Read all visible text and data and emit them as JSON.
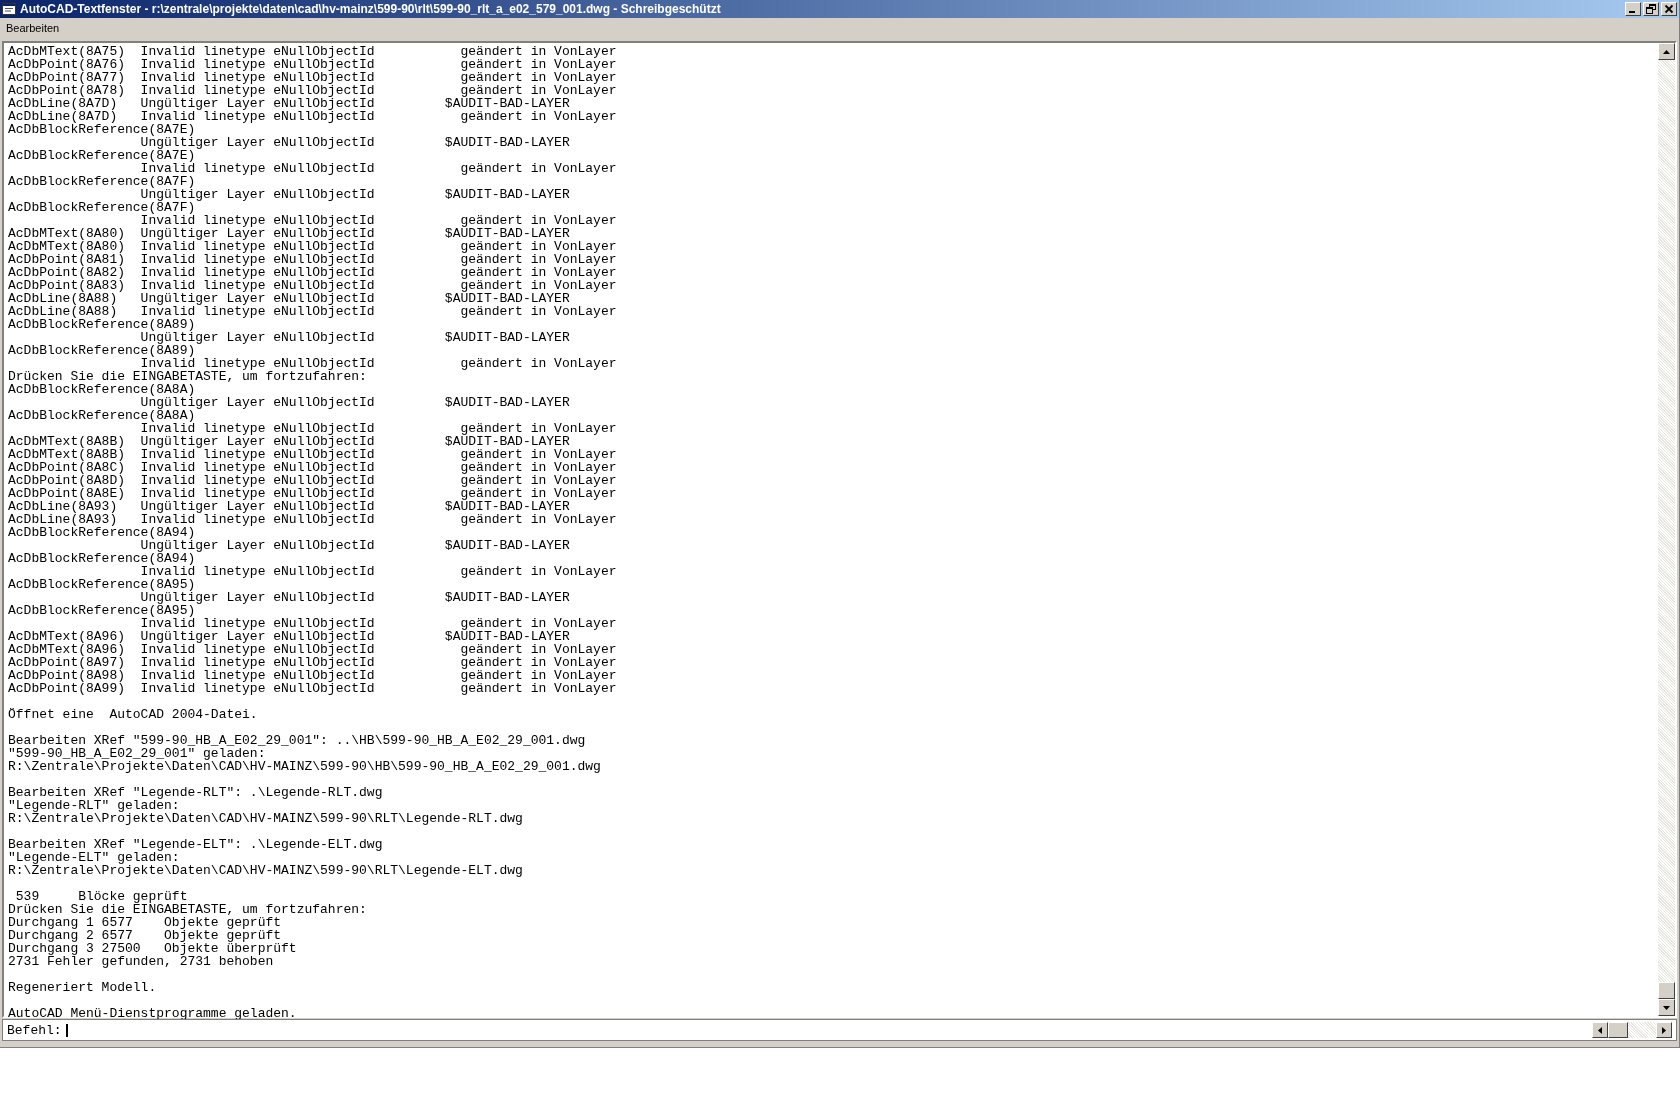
{
  "window": {
    "title": "AutoCAD-Textfenster - r:\\zentrale\\projekte\\daten\\cad\\hv-mainz\\599-90\\rlt\\599-90_rlt_a_e02_579_001.dwg - Schreibgeschützt"
  },
  "menu": [
    "Bearbeiten"
  ],
  "output_blocks": [
    [
      "AcDbMText(8A75)  Invalid linetype eNullObjectId           geändert in VonLayer",
      "AcDbPoint(8A76)  Invalid linetype eNullObjectId           geändert in VonLayer",
      "AcDbPoint(8A77)  Invalid linetype eNullObjectId           geändert in VonLayer",
      "AcDbPoint(8A78)  Invalid linetype eNullObjectId           geändert in VonLayer",
      "AcDbLine(8A7D)   Ungültiger Layer eNullObjectId         $AUDIT-BAD-LAYER",
      "AcDbLine(8A7D)   Invalid linetype eNullObjectId           geändert in VonLayer",
      "AcDbBlockReference(8A7E)",
      "                 Ungültiger Layer eNullObjectId         $AUDIT-BAD-LAYER",
      "AcDbBlockReference(8A7E)",
      "                 Invalid linetype eNullObjectId           geändert in VonLayer",
      "AcDbBlockReference(8A7F)",
      "                 Ungültiger Layer eNullObjectId         $AUDIT-BAD-LAYER",
      "AcDbBlockReference(8A7F)",
      "                 Invalid linetype eNullObjectId           geändert in VonLayer",
      "AcDbMText(8A80)  Ungültiger Layer eNullObjectId         $AUDIT-BAD-LAYER",
      "AcDbMText(8A80)  Invalid linetype eNullObjectId           geändert in VonLayer",
      "AcDbPoint(8A81)  Invalid linetype eNullObjectId           geändert in VonLayer",
      "AcDbPoint(8A82)  Invalid linetype eNullObjectId           geändert in VonLayer",
      "AcDbPoint(8A83)  Invalid linetype eNullObjectId           geändert in VonLayer",
      "AcDbLine(8A88)   Ungültiger Layer eNullObjectId         $AUDIT-BAD-LAYER",
      "AcDbLine(8A88)   Invalid linetype eNullObjectId           geändert in VonLayer",
      "AcDbBlockReference(8A89)",
      "                 Ungültiger Layer eNullObjectId         $AUDIT-BAD-LAYER",
      "AcDbBlockReference(8A89)",
      "                 Invalid linetype eNullObjectId           geändert in VonLayer",
      "Drücken Sie die EINGABETASTE, um fortzufahren:",
      "AcDbBlockReference(8A8A)",
      "                 Ungültiger Layer eNullObjectId         $AUDIT-BAD-LAYER",
      "AcDbBlockReference(8A8A)",
      "                 Invalid linetype eNullObjectId           geändert in VonLayer",
      "AcDbMText(8A8B)  Ungültiger Layer eNullObjectId         $AUDIT-BAD-LAYER",
      "AcDbMText(8A8B)  Invalid linetype eNullObjectId           geändert in VonLayer",
      "AcDbPoint(8A8C)  Invalid linetype eNullObjectId           geändert in VonLayer",
      "AcDbPoint(8A8D)  Invalid linetype eNullObjectId           geändert in VonLayer",
      "AcDbPoint(8A8E)  Invalid linetype eNullObjectId           geändert in VonLayer",
      "AcDbLine(8A93)   Ungültiger Layer eNullObjectId         $AUDIT-BAD-LAYER",
      "AcDbLine(8A93)   Invalid linetype eNullObjectId           geändert in VonLayer",
      "AcDbBlockReference(8A94)",
      "                 Ungültiger Layer eNullObjectId         $AUDIT-BAD-LAYER",
      "AcDbBlockReference(8A94)",
      "                 Invalid linetype eNullObjectId           geändert in VonLayer",
      "AcDbBlockReference(8A95)",
      "                 Ungültiger Layer eNullObjectId         $AUDIT-BAD-LAYER",
      "AcDbBlockReference(8A95)",
      "                 Invalid linetype eNullObjectId           geändert in VonLayer",
      "AcDbMText(8A96)  Ungültiger Layer eNullObjectId         $AUDIT-BAD-LAYER",
      "AcDbMText(8A96)  Invalid linetype eNullObjectId           geändert in VonLayer",
      "AcDbPoint(8A97)  Invalid linetype eNullObjectId           geändert in VonLayer",
      "AcDbPoint(8A98)  Invalid linetype eNullObjectId           geändert in VonLayer",
      "AcDbPoint(8A99)  Invalid linetype eNullObjectId           geändert in VonLayer"
    ],
    [
      "Öffnet eine  AutoCAD 2004-Datei."
    ],
    [
      "Bearbeiten XRef \"599-90_HB_A_E02_29_001\": ..\\HB\\599-90_HB_A_E02_29_001.dwg",
      "\"599-90_HB_A_E02_29_001\" geladen:",
      "R:\\Zentrale\\Projekte\\Daten\\CAD\\HV-MAINZ\\599-90\\HB\\599-90_HB_A_E02_29_001.dwg"
    ],
    [
      "Bearbeiten XRef \"Legende-RLT\": .\\Legende-RLT.dwg",
      "\"Legende-RLT\" geladen:",
      "R:\\Zentrale\\Projekte\\Daten\\CAD\\HV-MAINZ\\599-90\\RLT\\Legende-RLT.dwg"
    ],
    [
      "Bearbeiten XRef \"Legende-ELT\": .\\Legende-ELT.dwg",
      "\"Legende-ELT\" geladen:",
      "R:\\Zentrale\\Projekte\\Daten\\CAD\\HV-MAINZ\\599-90\\RLT\\Legende-ELT.dwg"
    ],
    [
      " 539     Blöcke geprüft",
      "Drücken Sie die EINGABETASTE, um fortzufahren:",
      "Durchgang 1 6577    Objekte geprüft",
      "Durchgang 2 6577    Objekte geprüft",
      "Durchgang 3 27500   Objekte überprüft",
      "2731 Fehler gefunden, 2731 behoben"
    ],
    [
      "Regeneriert Modell."
    ],
    [
      "AutoCAD Menü-Dienstprogramme geladen."
    ]
  ],
  "command_line": {
    "prompt": "Befehl:"
  }
}
